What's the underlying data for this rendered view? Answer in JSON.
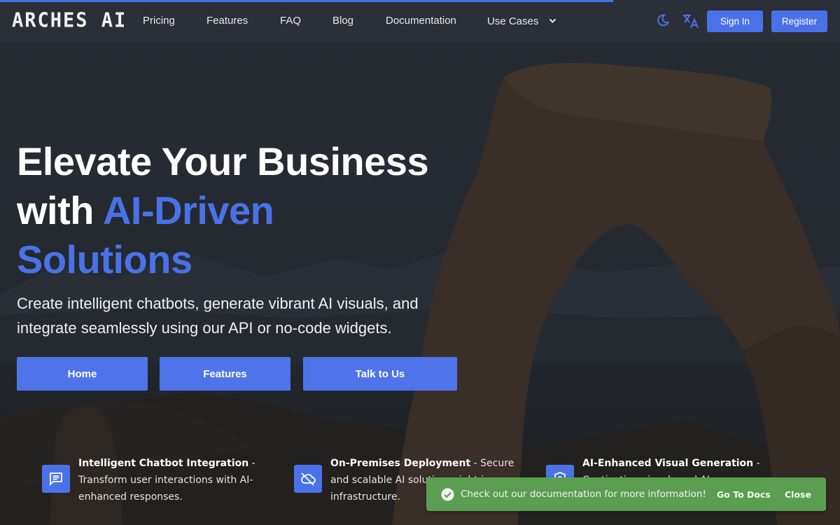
{
  "progress": {
    "value_percent": 73
  },
  "nav": {
    "logo": "ARCHES AI",
    "links": [
      {
        "label": "Pricing"
      },
      {
        "label": "Features"
      },
      {
        "label": "FAQ"
      },
      {
        "label": "Blog"
      },
      {
        "label": "Documentation"
      },
      {
        "label": "Use Cases"
      }
    ],
    "icons": {
      "theme_toggle": "moon-icon",
      "language": "translate-icon",
      "dropdown": "chevron-down-icon"
    },
    "sign_in_label": "Sign In",
    "register_label": "Register"
  },
  "hero": {
    "title_line1": "Elevate Your Business",
    "title_line2_plain": "with ",
    "title_line2_accent": "AI-Driven",
    "title_line3_accent": "Solutions",
    "subtitle": "Create intelligent chatbots, generate vibrant AI visuals, and integrate seamlessly using our API or no-code widgets.",
    "buttons": [
      {
        "label": "Home"
      },
      {
        "label": "Features"
      },
      {
        "label": "Talk to Us"
      }
    ]
  },
  "features": [
    {
      "icon": "chat-bubble-icon",
      "title": "Intelligent Chatbot Integration",
      "separator": " - ",
      "description": "Transform user interactions with AI-enhanced responses."
    },
    {
      "icon": "cloud-off-icon",
      "title": "On-Premises Deployment",
      "separator": " - ",
      "description": "Secure and scalable AI solutions right in your infrastructure."
    },
    {
      "icon": "camera-shield-icon",
      "title": "AI-Enhanced Visual Generation",
      "separator": " -",
      "description": "Captivating visuals and AI..."
    }
  ],
  "snackbar": {
    "icon": "check-circle-icon",
    "message": "Check out our documentation for more information!",
    "action_label": "Go To Docs",
    "close_label": "Close"
  },
  "colors": {
    "accent": "#4a72e8",
    "nav_bg": "#2c3038",
    "snackbar_bg": "#5b9e52"
  }
}
